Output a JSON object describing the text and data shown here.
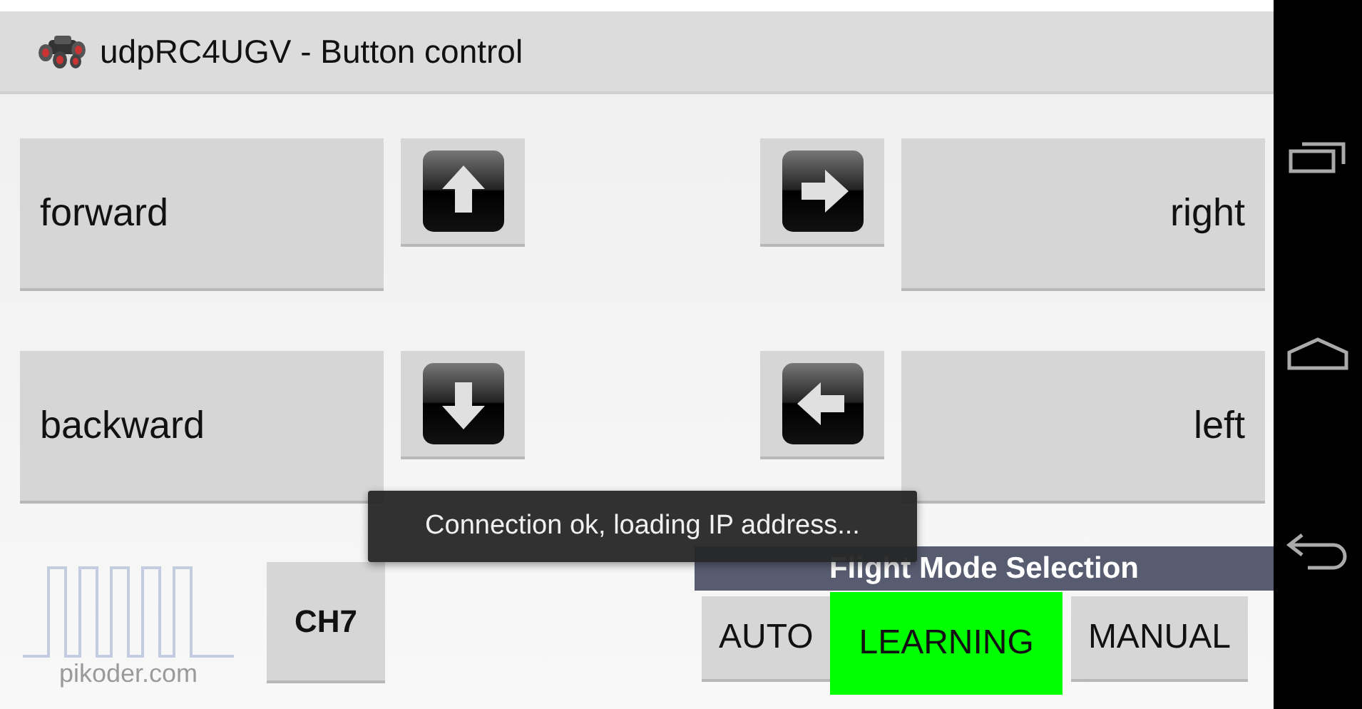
{
  "title_bar": {
    "title": "udpRC4UGV - Button control"
  },
  "rows": [
    {
      "left": {
        "label": "forward",
        "kind": "up"
      },
      "right": {
        "label": "right",
        "kind": "right"
      }
    },
    {
      "left": {
        "label": "backward",
        "kind": "down"
      },
      "right": {
        "label": "left",
        "kind": "left"
      }
    }
  ],
  "logo": {
    "caption": "pikoder.com"
  },
  "channel_button": {
    "label": "CH7"
  },
  "flight_mode": {
    "title": "Flight Mode Selection",
    "modes": [
      {
        "label": "AUTO",
        "selected": false
      },
      {
        "label": "LEARNING",
        "selected": true
      },
      {
        "label": "MANUAL",
        "selected": false
      }
    ]
  },
  "toast": {
    "message": "Connection ok, loading IP address..."
  }
}
